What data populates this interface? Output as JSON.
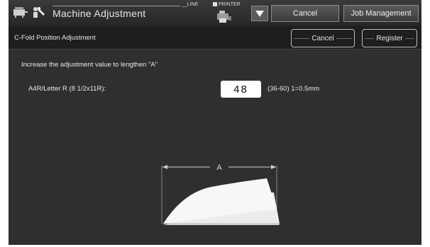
{
  "header": {
    "title": "Machine Adjustment",
    "line_label": "LINE",
    "printer_label": "PRINTER",
    "cancel_label": "Cancel",
    "job_management_label": "Job Management"
  },
  "subheader": {
    "title": "C-Fold Position Adjustment",
    "cancel_label": "Cancel",
    "register_label": "Register"
  },
  "main": {
    "instruction": "Increase the adjustment value to  lengthen \"A\"",
    "paper_size_label": "A4R/Letter R (8 1/2x11R):",
    "value": "48",
    "range_text": "(36-60) 1=0.5mm",
    "diagram_label": "A"
  },
  "icons": {
    "title": "machine-adjustment-icon",
    "printer": "printer-icon",
    "dropdown": "triangle-down-icon"
  }
}
